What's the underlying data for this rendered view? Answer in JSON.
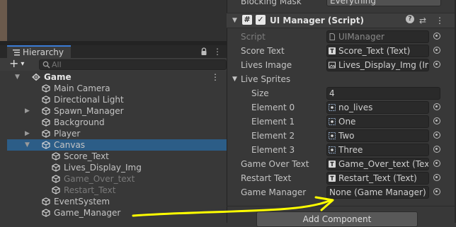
{
  "hierarchy": {
    "tab_label": "Hierarchy",
    "add_symbol": "+",
    "dropdown_symbol": "▾",
    "lock_symbol": "🔒",
    "menu_symbol": "⋮",
    "search_placeholder": "All",
    "side_stub": "n",
    "items": [
      {
        "label": "Game",
        "depth": 0,
        "expand": "open",
        "icon": "unity-scene-icon",
        "bold": true,
        "selected": false,
        "dim": false
      },
      {
        "label": "Main Camera",
        "depth": 1,
        "expand": "none",
        "icon": "gameobject-cube-icon",
        "bold": false,
        "selected": false,
        "dim": false
      },
      {
        "label": "Directional Light",
        "depth": 1,
        "expand": "none",
        "icon": "gameobject-cube-icon",
        "bold": false,
        "selected": false,
        "dim": false
      },
      {
        "label": "Spawn_Manager",
        "depth": 1,
        "expand": "closed",
        "icon": "gameobject-cube-icon",
        "bold": false,
        "selected": false,
        "dim": false
      },
      {
        "label": "Background",
        "depth": 1,
        "expand": "none",
        "icon": "gameobject-cube-icon",
        "bold": false,
        "selected": false,
        "dim": false
      },
      {
        "label": "Player",
        "depth": 1,
        "expand": "closed",
        "icon": "gameobject-cube-icon",
        "bold": false,
        "selected": false,
        "dim": false
      },
      {
        "label": "Canvas",
        "depth": 1,
        "expand": "open",
        "icon": "gameobject-cube-icon",
        "bold": false,
        "selected": true,
        "dim": false
      },
      {
        "label": "Score_Text",
        "depth": 2,
        "expand": "none",
        "icon": "gameobject-cube-icon",
        "bold": false,
        "selected": false,
        "dim": false
      },
      {
        "label": "Lives_Display_Img",
        "depth": 2,
        "expand": "none",
        "icon": "gameobject-cube-icon",
        "bold": false,
        "selected": false,
        "dim": false
      },
      {
        "label": "Game_Over_text",
        "depth": 2,
        "expand": "none",
        "icon": "gameobject-cube-icon",
        "bold": false,
        "selected": false,
        "dim": true
      },
      {
        "label": "Restart_Text",
        "depth": 2,
        "expand": "none",
        "icon": "gameobject-cube-icon",
        "bold": false,
        "selected": false,
        "dim": true
      },
      {
        "label": "EventSystem",
        "depth": 1,
        "expand": "none",
        "icon": "gameobject-cube-icon",
        "bold": false,
        "selected": false,
        "dim": false
      },
      {
        "label": "Game_Manager",
        "depth": 1,
        "expand": "none",
        "icon": "gameobject-cube-icon",
        "bold": false,
        "selected": false,
        "dim": false
      }
    ]
  },
  "inspector": {
    "blocking_mask_label": "Blocking Mask",
    "blocking_mask_value": "Everything",
    "component": {
      "title": "UI Manager (Script)",
      "hash_symbol": "#",
      "check_symbol": "✓",
      "help_symbol": "?",
      "settings_symbol": "⇄",
      "menu_symbol": "⋮",
      "collapse_symbol": "▼"
    },
    "fields": [
      {
        "label": "Script",
        "value": "UIManager",
        "icon": "script-file-icon",
        "dim": true,
        "picker": true,
        "indent": 0
      },
      {
        "label": "Score Text",
        "value": "Score_Text (Text)",
        "icon": "text-component-icon",
        "dim": false,
        "picker": true,
        "indent": 0
      },
      {
        "label": "Lives Image",
        "value": "Lives_Display_Img (Imag",
        "icon": "image-component-icon",
        "dim": false,
        "picker": true,
        "indent": 0
      },
      {
        "label": "Live Sprites",
        "value": "",
        "icon": "",
        "dim": false,
        "picker": false,
        "indent": 0,
        "foldout": true
      },
      {
        "label": "Size",
        "value": "4",
        "icon": "",
        "dim": false,
        "picker": false,
        "indent": 2,
        "plain": true
      },
      {
        "label": "Element 0",
        "value": "no_lives",
        "icon": "sprite-icon",
        "dim": false,
        "picker": true,
        "indent": 2
      },
      {
        "label": "Element 1",
        "value": "One",
        "icon": "sprite-icon",
        "dim": false,
        "picker": true,
        "indent": 2
      },
      {
        "label": "Element 2",
        "value": "Two",
        "icon": "sprite-icon",
        "dim": false,
        "picker": true,
        "indent": 2
      },
      {
        "label": "Element 3",
        "value": "Three",
        "icon": "sprite-icon",
        "dim": false,
        "picker": true,
        "indent": 2
      },
      {
        "label": "Game Over Text",
        "value": "Game_Over_text (Text)",
        "icon": "text-component-icon",
        "dim": false,
        "picker": true,
        "indent": 0
      },
      {
        "label": "Restart Text",
        "value": "Restart_Text (Text)",
        "icon": "text-component-icon",
        "dim": false,
        "picker": true,
        "indent": 0
      },
      {
        "label": "Game Manager",
        "value": "None (Game Manager)",
        "icon": "",
        "dim": false,
        "picker": true,
        "indent": 0,
        "plain": true
      }
    ],
    "add_component_label": "Add Component"
  },
  "annotation": {
    "type": "hand-drawn-arrow",
    "color": "#ffff00",
    "from": "Game_Manager",
    "to": "Game Manager"
  },
  "colors": {
    "selection": "#2c5d87",
    "panel": "#383838",
    "field": "#2a2a2a",
    "accent_tab": "#3a7bd5",
    "arrow": "#ffff00"
  }
}
